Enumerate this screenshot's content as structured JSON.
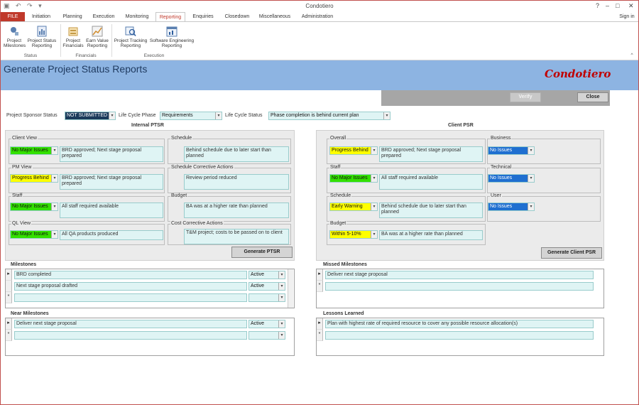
{
  "window": {
    "title": "Condotiero",
    "help": "?",
    "minimize": "–",
    "maximize": "□",
    "close": "✕",
    "signin": "Sign in"
  },
  "quick_access": "▣ ↶ ↷ ▾",
  "tabs": [
    "FILE",
    "Initiation",
    "Planning",
    "Execution",
    "Monitoring",
    "Reporting",
    "Enquiries",
    "Closedown",
    "Miscellaneous",
    "Administration"
  ],
  "ribbon": {
    "buttons": [
      "Project Milestones",
      "Project Status Reporting",
      "Project Financials",
      "Earn Value Reporting",
      "Project Tracking Reporting",
      "Software Engineering Reporting"
    ],
    "groups": [
      "Status",
      "Financials",
      "Execution"
    ],
    "collapse": "^"
  },
  "header": {
    "title": "Generate Project Status Reports",
    "logo": "Condotiero"
  },
  "actions": {
    "verify": "Verify",
    "close": "Close"
  },
  "top_fields": {
    "sponsor_label": "Project Sponsor Status",
    "sponsor_value": "NOT SUBMITTED",
    "phase_label": "Life Cycle Phase",
    "phase_value": "Requirements",
    "status_label": "Life Cycle Status",
    "status_value": "Phase completion is behind current plan"
  },
  "internal": {
    "title": "Internal PTSR",
    "client_view": {
      "title": "Client View",
      "status": "No Major Issues",
      "comment": "BRD approved; Next stage proposal prepared"
    },
    "pm_view": {
      "title": "PM View",
      "status": "Progress Behind",
      "comment": "BRD approved; Next stage proposal prepared"
    },
    "staff": {
      "title": "Staff",
      "status": "No Major Issues",
      "comment": "All staff required available"
    },
    "ql_view": {
      "title": "QL View",
      "status": "No Major Issues",
      "comment": "All QA products produced"
    },
    "schedule": {
      "title": "Schedule",
      "comment": "Behind schedule due to later start than planned"
    },
    "schedule_ca": {
      "title": "Schedule Corrective Actions",
      "comment": "Review period reduced"
    },
    "budget": {
      "title": "Budget",
      "comment": "BA was at a higher rate than planned"
    },
    "cost_ca": {
      "title": "Cost Corrective Actions",
      "comment": "T&M project; costs to be passed on to client"
    },
    "generate": "Generate PTSR"
  },
  "client": {
    "title": "Client PSR",
    "overall": {
      "title": "Overall",
      "status": "Progress Behind",
      "comment": "BRD approved; Next stage proposal prepared"
    },
    "staff": {
      "title": "Staff",
      "status": "No Major Issues",
      "comment": "All staff required available"
    },
    "schedule": {
      "title": "Schedule",
      "status": "Early Warning",
      "comment": "Behind schedule due to later start than planned"
    },
    "budget": {
      "title": "Budget",
      "status": "Within 5-10%",
      "comment": "BA was at a higher rate than planned"
    },
    "business": {
      "title": "Business",
      "status": "No Issues"
    },
    "technical": {
      "title": "Technical",
      "status": "No Issues"
    },
    "user": {
      "title": "User",
      "status": "No Issues"
    },
    "generate": "Generate Client PSR"
  },
  "milestones": {
    "title": "Milestones",
    "rows": [
      {
        "name": "BRD completed",
        "state": "Active"
      },
      {
        "name": "Next stage proposal drafted",
        "state": "Active"
      }
    ]
  },
  "missed_milestones": {
    "title": "Missed Milestones",
    "rows": [
      "Deliver next stage proposal"
    ]
  },
  "near_milestones": {
    "title": "Near Milestones",
    "rows": [
      {
        "name": "Deliver next stage proposal",
        "state": "Active"
      }
    ]
  },
  "lessons": {
    "title": "Lessons Learned",
    "rows": [
      "Plan with highest rate of required resource to cover any possible resource allocation(s)"
    ]
  },
  "colors": {
    "green": "#33e000",
    "yellow": "#ffff00",
    "blue": "#1f6fd0",
    "header": "#8db4e2",
    "file_tab": "#c0392b"
  }
}
